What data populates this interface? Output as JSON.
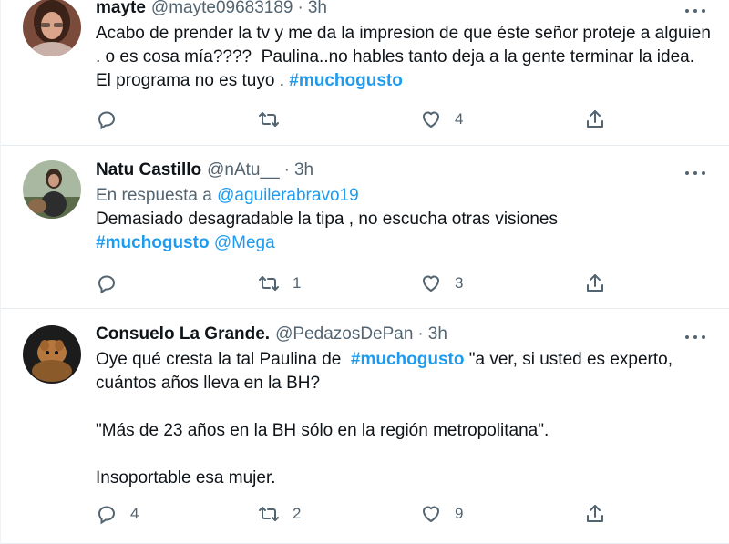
{
  "tweets": [
    {
      "name": "mayte",
      "handle": "@mayte09683189",
      "dot": "·",
      "time": "3h",
      "text_parts": [
        "Acabo de prender la tv y me da la impresion de que éste señor proteje a alguien . o es cosa mía????  Paulina..no hables tanto deja a la gente terminar la idea. El programa no es tuyo . ",
        "#muchogusto"
      ],
      "counts": {
        "reply": "",
        "retweet": "",
        "like": "4"
      }
    },
    {
      "name": "Natu Castillo",
      "handle": "@nAtu__",
      "dot": "·",
      "time": "3h",
      "reply_prefix": "En respuesta a",
      "reply_mention": "@aguilerabravo19",
      "text_parts": [
        "Demasiado desagradable la tipa , no escucha otras visiones",
        "#muchogusto",
        "@Mega"
      ],
      "counts": {
        "reply": "",
        "retweet": "1",
        "like": "3"
      }
    },
    {
      "name": "Consuelo La Grande.",
      "handle": "@PedazosDePan",
      "dot": "·",
      "time": "3h",
      "text_parts": [
        "Oye qué cresta la tal Paulina de  ",
        "#muchogusto",
        " \"a ver, si usted es experto, cuántos años lleva en la BH?\n\n\"Más de 23 años en la BH sólo en la región metropolitana\".\n\nInsoportable esa mujer."
      ],
      "counts": {
        "reply": "4",
        "retweet": "2",
        "like": "9"
      }
    }
  ],
  "icons": {
    "reply": "reply-icon",
    "retweet": "retweet-icon",
    "like": "like-icon",
    "share": "share-icon",
    "more": "more-icon"
  },
  "colors": {
    "link": "#1d9bf0",
    "secondary": "#536471",
    "text": "#0f1419",
    "divider": "#e6ecf0"
  }
}
